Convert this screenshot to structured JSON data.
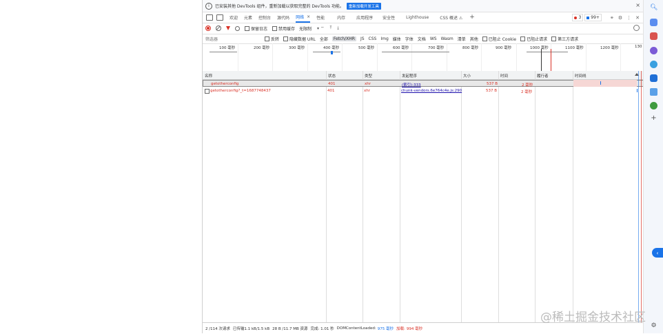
{
  "infobar": {
    "text": "已安装其他 DevTools 组件，重新加载以获取完整的 DevTools 功能。",
    "button": "重新加载开发工具",
    "close": "×"
  },
  "tabs": [
    {
      "label": "欢迎"
    },
    {
      "label": "元素"
    },
    {
      "label": "控制台"
    },
    {
      "label": "源代码"
    },
    {
      "label": "网络",
      "active": true,
      "close": "×"
    },
    {
      "label": "性能"
    },
    {
      "label": "内存"
    },
    {
      "label": "应用程序"
    },
    {
      "label": "安全性"
    },
    {
      "label": "Lighthouse"
    },
    {
      "label": "CSS 概述 ⚠"
    }
  ],
  "tabs_right": {
    "errors": "3",
    "warnings": "99+"
  },
  "toolbar": {
    "preserve_log": "保留日志",
    "disable_cache": "禁用缓存",
    "throttle": "无限制"
  },
  "filter": {
    "placeholder": "筛选器",
    "invert": "反转",
    "hide_data_urls": "隐藏数据 URL",
    "types": [
      "全部",
      "Fetch/XHR",
      "JS",
      "CSS",
      "Img",
      "媒体",
      "字体",
      "文档",
      "WS",
      "Wasm",
      "清单",
      "其他"
    ],
    "blocked_cookies": "已阻止 Cookie",
    "blocked_requests": "已阻止请求",
    "third_party": "第三方请求"
  },
  "overview_ticks": [
    "100 毫秒",
    "200 毫秒",
    "300 毫秒",
    "400 毫秒",
    "500 毫秒",
    "600 毫秒",
    "700 毫秒",
    "800 毫秒",
    "900 毫秒",
    "1000 毫秒",
    "1100 毫秒",
    "1200 毫秒",
    "130"
  ],
  "table": {
    "headers": [
      "名称",
      "状态",
      "类型",
      "发起程序",
      "大小",
      "时间",
      "履行者",
      "时间线"
    ],
    "rows": [
      {
        "name": "getotherconfig",
        "status": "401",
        "type": "xhr",
        "initiator": "(索引):333",
        "size": "537 B",
        "time": "2 毫秒"
      },
      {
        "name": "getotherconfig?_t=1687748437",
        "status": "401",
        "type": "xhr",
        "initiator": "chunk-vendors.6e764c4e.js:290",
        "size": "537 B",
        "time": "2 毫秒"
      }
    ]
  },
  "status": {
    "requests": "2 /114 次请求",
    "transferred": "已传输1.1 kB/1.5 kB",
    "resources": "28 B /11.7 MB 资源",
    "finish": "完成: 1.01 秒",
    "dcl_label": "DOMContentLoaded:",
    "dcl_value": "975 毫秒",
    "load_label": "加载:",
    "load_value": "994 毫秒"
  },
  "watermark": "@稀土掘金技术社区",
  "colors": {
    "accent": "#1a73e8",
    "error": "#d93025"
  }
}
